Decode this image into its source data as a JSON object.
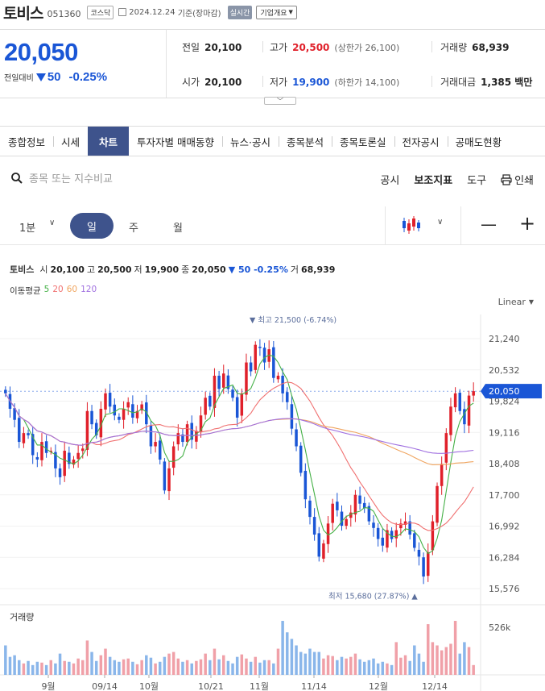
{
  "header": {
    "name": "토비스",
    "code": "051360",
    "market": "코스닥",
    "date": "2024.12.24",
    "basis": "기준(장마감)",
    "realtime": "실시간",
    "corp_info": "기업개요"
  },
  "price": {
    "current": "20,050",
    "change_label": "전일대비",
    "change": "50",
    "change_pct": "-0.25%",
    "prev_close_label": "전일",
    "prev_close": "20,100",
    "high_label": "고가",
    "high": "20,500",
    "upper_limit": "(상한가 26,100)",
    "volume_label": "거래량",
    "volume": "68,939",
    "open_label": "시가",
    "open": "20,100",
    "low_label": "저가",
    "low": "19,900",
    "lower_limit": "(하한가 14,100)",
    "amount_label": "거래대금",
    "amount": "1,385 백만"
  },
  "tabs": [
    "종합정보",
    "시세",
    "차트",
    "투자자별 매매동향",
    "뉴스·공시",
    "종목분석",
    "종목토론실",
    "전자공시",
    "공매도현황"
  ],
  "active_tab": "차트",
  "search": {
    "placeholder": "종목 또는 지수비교"
  },
  "tools": {
    "notice": "공시",
    "indicator": "보조지표",
    "tool": "도구",
    "print": "인쇄"
  },
  "periods": {
    "minute": "1분",
    "day": "일",
    "week": "주",
    "month": "월"
  },
  "chart_info": {
    "name": "토비스",
    "open_label": "시",
    "open": "20,100",
    "high_label": "고",
    "high": "20,500",
    "low_label": "저",
    "low": "19,900",
    "close_label": "종",
    "close": "20,050",
    "change": "▼ 50 -0.25%",
    "vol_label": "거",
    "volume": "68,939",
    "ma_label": "이동평균",
    "ma_5": "5",
    "ma_20": "20",
    "ma_60": "60",
    "ma_120": "120",
    "scale": "Linear",
    "volume_title": "거래량"
  },
  "colors": {
    "up": "#e0202a",
    "down": "#1a56d6",
    "brand": "#3e538c",
    "ma5": "#44b046",
    "ma20": "#f07070",
    "ma60": "#f0a560",
    "ma120": "#a070e0"
  },
  "chart_data": {
    "type": "candlestick",
    "y_ticks": [
      "21,240",
      "20,532",
      "19,824",
      "19,116",
      "18,408",
      "17,700",
      "16,992",
      "16,284",
      "15,576"
    ],
    "ylim": [
      15576,
      21240
    ],
    "x_ticks": [
      "9월",
      "09/14",
      "10월",
      "10/21",
      "11월",
      "11/14",
      "12월",
      "12/14"
    ],
    "last_price": "20,050",
    "last_value": 20050,
    "max_label": "▼ 최고 21,500 (-6.74%)",
    "max_value": 21500,
    "min_label": "최저 15,680 (27.87%) ▲",
    "min_value": 15680,
    "volume_tick": "526k",
    "volume_tick_value": 526000,
    "closes": [
      20000,
      19650,
      19400,
      18900,
      19100,
      19050,
      18600,
      18500,
      18900,
      18650,
      18700,
      18300,
      18100,
      18700,
      18400,
      18500,
      18650,
      18750,
      19600,
      19300,
      19050,
      19650,
      20000,
      19700,
      19500,
      19400,
      19650,
      19800,
      19450,
      19600,
      19750,
      19300,
      18800,
      18900,
      18500,
      17800,
      18300,
      18800,
      19100,
      18900,
      19300,
      18950,
      19150,
      19500,
      19900,
      19700,
      20400,
      20100,
      20450,
      20100,
      19900,
      19450,
      20000,
      20700,
      20500,
      21100,
      21050,
      20700,
      21000,
      20350,
      20400,
      20000,
      19800,
      19200,
      18800,
      18200,
      17600,
      17200,
      16800,
      16300,
      16600,
      17050,
      17500,
      17350,
      17000,
      17150,
      17300,
      17700,
      17500,
      17400,
      17100,
      16950,
      16700,
      16550,
      16900,
      16700,
      16900,
      17050,
      17100,
      16800,
      16500,
      16300,
      15850,
      16400,
      17100,
      17900,
      18400,
      19100,
      19700,
      20000,
      19600,
      19300,
      19950,
      20050
    ],
    "volumes": [
      180000,
      110000,
      120000,
      90000,
      70000,
      85000,
      60000,
      80000,
      75000,
      60000,
      90000,
      70000,
      130000,
      85000,
      80000,
      70000,
      100000,
      90000,
      210000,
      140000,
      85000,
      120000,
      160000,
      110000,
      90000,
      80000,
      95000,
      100000,
      80000,
      65000,
      90000,
      120000,
      105000,
      70000,
      80000,
      110000,
      130000,
      140000,
      100000,
      80000,
      90000,
      70000,
      85000,
      95000,
      130000,
      90000,
      160000,
      95000,
      120000,
      85000,
      70000,
      110000,
      125000,
      100000,
      80000,
      110000,
      75000,
      90000,
      90000,
      70000,
      160000,
      330000,
      260000,
      220000,
      180000,
      140000,
      130000,
      160000,
      140000,
      140000,
      100000,
      120000,
      115000,
      90000,
      110000,
      100000,
      110000,
      130000,
      95000,
      80000,
      90000,
      100000,
      70000,
      80000,
      70000,
      60000,
      200000,
      105000,
      120000,
      85000,
      180000,
      130000,
      80000,
      310000,
      200000,
      180000,
      150000,
      170000,
      190000,
      330000,
      130000,
      200000,
      170000,
      60000
    ]
  }
}
